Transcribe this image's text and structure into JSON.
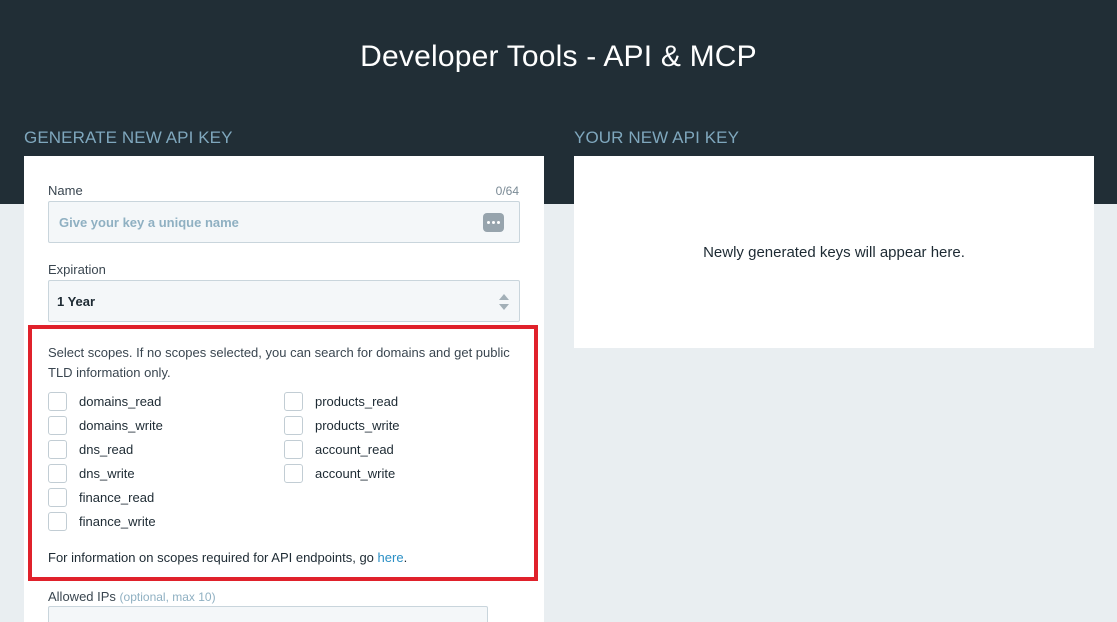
{
  "header": {
    "title": "Developer Tools - API & MCP"
  },
  "generate": {
    "heading": "GENERATE NEW API KEY",
    "name": {
      "label": "Name",
      "count": "0/64",
      "value": "",
      "placeholder": "Give your key a unique name",
      "icon": "dots-icon"
    },
    "expiration": {
      "label": "Expiration",
      "value": "1 Year",
      "icon": "updown-icon"
    },
    "scopes": {
      "intro": "Select scopes. If no scopes selected, you can search for domains and get public TLD information only.",
      "items": [
        {
          "label": "domains_read",
          "checked": false
        },
        {
          "label": "domains_write",
          "checked": false
        },
        {
          "label": "dns_read",
          "checked": false
        },
        {
          "label": "dns_write",
          "checked": false
        },
        {
          "label": "finance_read",
          "checked": false
        },
        {
          "label": "finance_write",
          "checked": false
        },
        {
          "label": "products_read",
          "checked": false
        },
        {
          "label": "products_write",
          "checked": false
        },
        {
          "label": "account_read",
          "checked": false
        },
        {
          "label": "account_write",
          "checked": false
        }
      ],
      "footer_text": "For information on scopes required for API endpoints, go ",
      "footer_link": "here",
      "footer_end": "."
    },
    "allowed_ips": {
      "label": "Allowed IPs",
      "hint": "(optional, max 10)"
    }
  },
  "result": {
    "heading": "YOUR NEW API KEY",
    "empty_message": "Newly generated keys will appear here."
  },
  "colors": {
    "header_bg": "#212e36",
    "heading": "#7fa7bd",
    "highlight_border": "#e0212b",
    "link": "#2a8fc5"
  }
}
